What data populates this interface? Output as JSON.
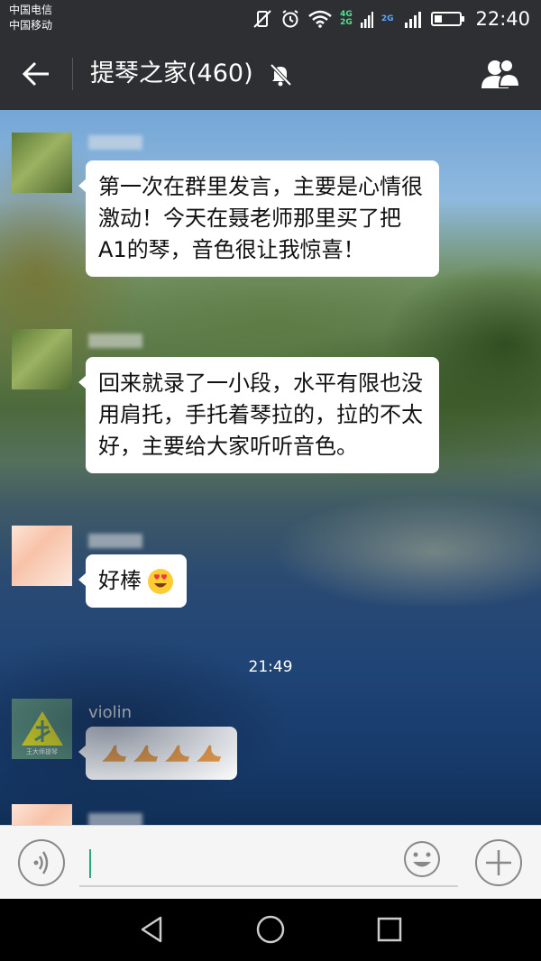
{
  "status_bar": {
    "carrier_1": "中国电信",
    "carrier_2": "中国移动",
    "network_1": "4G",
    "network_1b": "2G",
    "network_2": "2G",
    "time": "22:40"
  },
  "header": {
    "title": "提琴之家(460)"
  },
  "messages": [
    {
      "sender": "",
      "text": "第一次在群里发言，主要是心情很激动！今天在聂老师那里买了把A1的琴，音色很让我惊喜！"
    },
    {
      "sender": "",
      "text": "回来就录了一小段，水平有限也没用肩托，手托着琴拉的，拉的不太好，主要给大家听听音色。"
    },
    {
      "sender": "",
      "text": "好棒"
    },
    {
      "sender": "violin",
      "text": ""
    }
  ],
  "timestamp": "21:49",
  "violin_avatar_caption": "王大师提琴",
  "input": {
    "value": "",
    "placeholder": ""
  },
  "colors": {
    "header_bg": "#2d2f33",
    "accent": "#2aa87a"
  }
}
